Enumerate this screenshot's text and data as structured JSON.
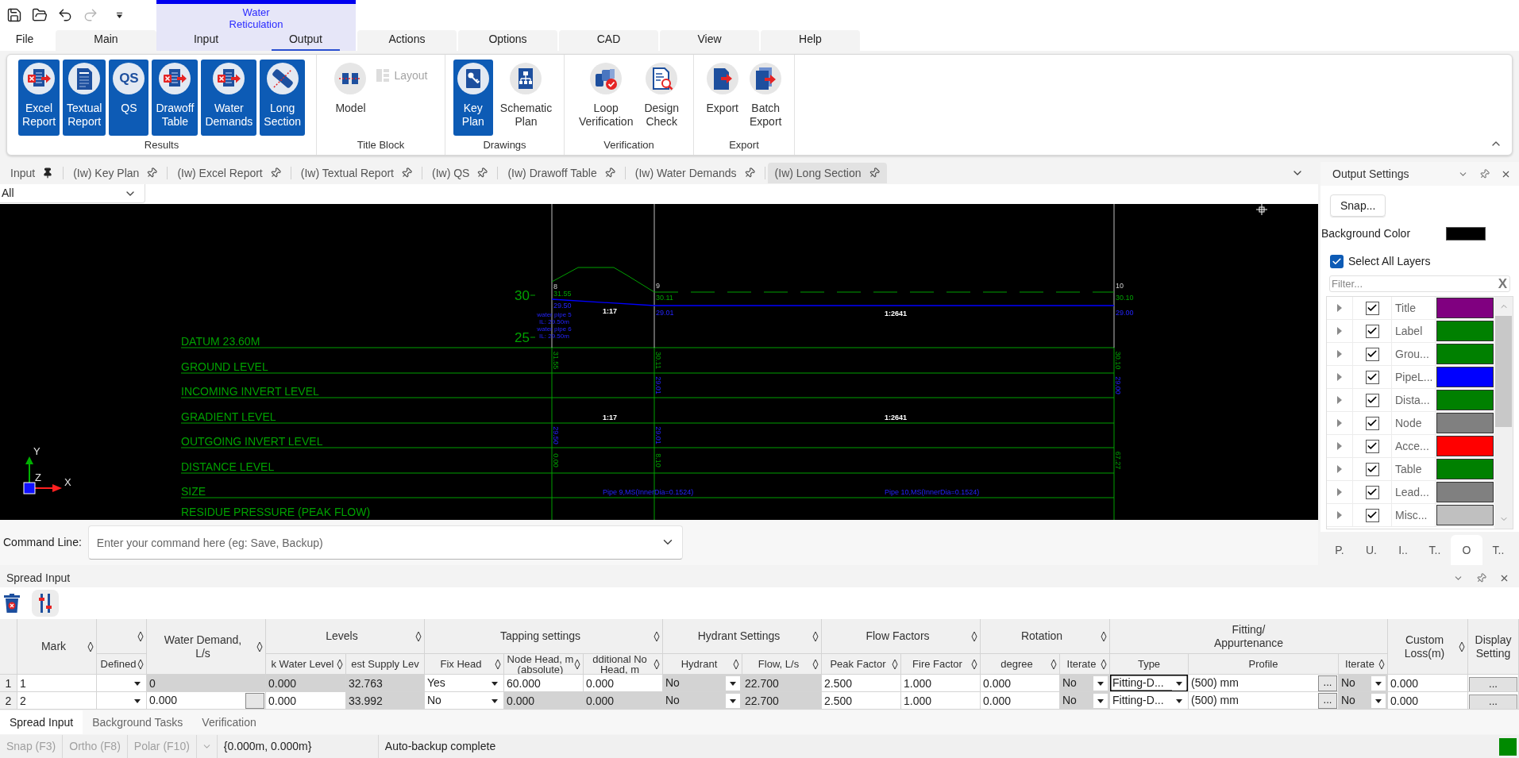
{
  "quick_access": [
    {
      "disabled": false
    },
    {
      "disabled": false
    },
    {
      "disabled": false
    },
    {
      "disabled": true
    },
    {
      "disabled": false
    }
  ],
  "menu": {
    "tabs_before": [
      {
        "label": "File",
        "kind": "backstage",
        "selected": false
      },
      {
        "label": "Main",
        "kind": "tab",
        "selected": false
      }
    ],
    "context_group": {
      "title": "Water Reticulation",
      "tabs": [
        {
          "label": "Input",
          "selected": false
        },
        {
          "label": "Output",
          "selected": true
        }
      ]
    },
    "tabs_after": [
      {
        "label": "Actions",
        "kind": "tab",
        "selected": false
      },
      {
        "label": "Options",
        "kind": "tab",
        "selected": false
      },
      {
        "label": "CAD",
        "kind": "tab",
        "selected": false
      },
      {
        "label": "View",
        "kind": "tab",
        "selected": false
      },
      {
        "label": "Help",
        "kind": "tab",
        "selected": false
      }
    ]
  },
  "ribbon": {
    "groups": [
      {
        "label": "Results",
        "buttons": [
          {
            "label": "Excel Report",
            "kind": "large",
            "selected": true,
            "disabled": false
          },
          {
            "label": "Textual Report",
            "kind": "large",
            "selected": true,
            "disabled": false
          },
          {
            "label": "QS",
            "icon_text": "QS",
            "kind": "large",
            "selected": true,
            "disabled": false
          },
          {
            "label": "Drawoff Table",
            "kind": "large",
            "selected": true,
            "disabled": false
          },
          {
            "label": "Water Demands",
            "kind": "large",
            "selected": true,
            "disabled": false
          },
          {
            "label": "Long Section",
            "kind": "large",
            "selected": true,
            "disabled": false
          }
        ]
      },
      {
        "label": "Title Block",
        "buttons": [
          {
            "label": "Model",
            "kind": "large",
            "selected": false,
            "disabled": false
          },
          {
            "label": "Layout",
            "kind": "small",
            "selected": false,
            "disabled": true
          }
        ]
      },
      {
        "label": "Drawings",
        "buttons": [
          {
            "label": "Key Plan",
            "kind": "large",
            "selected": true,
            "disabled": false
          },
          {
            "label": "Schematic Plan",
            "kind": "large",
            "selected": false,
            "disabled": false
          }
        ]
      },
      {
        "label": "Verification",
        "buttons": [
          {
            "label": "Loop Verification",
            "kind": "large",
            "selected": false,
            "disabled": false
          },
          {
            "label": "Design Check",
            "kind": "large",
            "selected": false,
            "disabled": false
          }
        ]
      },
      {
        "label": "Export",
        "buttons": [
          {
            "label": "Export",
            "kind": "large",
            "selected": false,
            "disabled": false
          },
          {
            "label": "Batch Export",
            "kind": "large",
            "selected": false,
            "disabled": false
          }
        ]
      }
    ]
  },
  "document_tabs": [
    {
      "label": "Input",
      "pinned": true,
      "selected": false
    },
    {
      "label": "(Iw) Key Plan",
      "pinned": false,
      "selected": false
    },
    {
      "label": "(Iw) Excel Report",
      "pinned": false,
      "selected": false
    },
    {
      "label": "(Iw) Textual Report",
      "pinned": false,
      "selected": false
    },
    {
      "label": "(Iw) QS",
      "pinned": false,
      "selected": false
    },
    {
      "label": "(Iw) Drawoff Table",
      "pinned": false,
      "selected": false
    },
    {
      "label": "(Iw) Water Demands",
      "pinned": false,
      "selected": false
    },
    {
      "label": "(Iw) Long Section",
      "pinned": false,
      "selected": true
    }
  ],
  "view_filter": {
    "value": "All"
  },
  "canvas": {
    "rows": [
      {
        "label": "DATUM 23.60M"
      },
      {
        "label": "GROUND LEVEL"
      },
      {
        "label": "INCOMING INVERT LEVEL"
      },
      {
        "label": "GRADIENT LEVEL"
      },
      {
        "label": "OUTGOING INVERT LEVEL"
      },
      {
        "label": "DISTANCE LEVEL"
      },
      {
        "label": "SIZE"
      },
      {
        "label": "RESIDUE PRESSURE (PEAK FLOW)"
      }
    ],
    "scale_labels": [
      "30",
      "25"
    ],
    "nodes": [
      {
        "label": "8",
        "ground": "31.55",
        "invert": "29.50",
        "ground_level_row": "31.55",
        "outgoing_invert_row": "29.50",
        "distance_row": "0.00"
      },
      {
        "label": "9",
        "ground": "30.11",
        "invert": "29.01",
        "ground_level_row": "30.11",
        "incoming_invert_row": "29.01",
        "outgoing_invert_row": "29.01",
        "distance_row": "8.10"
      },
      {
        "label": "10",
        "ground": "30.10",
        "invert": "29.00",
        "ground_level_row": "30.10",
        "incoming_invert_row": "29.00",
        "distance_row": "67.27"
      }
    ],
    "pipe_notes": [
      "water pipe 5",
      "IL: 29.50m",
      "water pipe 6",
      "IL: 29.50m"
    ],
    "pipes": [
      {
        "profile_gradient": "1:17",
        "row_gradient": "1:17",
        "size": "Pipe 9,MS(InnerDia=0.1524)"
      },
      {
        "profile_gradient": "1:2641",
        "row_gradient": "1:2641",
        "size": "Pipe 10,MS(InnerDia=0.1524)"
      }
    ],
    "axis_labels": [
      "Y",
      "Z",
      "X"
    ]
  },
  "command_line": {
    "label": "Command Line:",
    "placeholder": "Enter your command here (eg: Save, Backup)"
  },
  "output_settings": {
    "title": "Output Settings",
    "snap_button": "Snap...",
    "background": {
      "label": "Background Color",
      "color": "#000000"
    },
    "select_all": {
      "label": "Select All Layers",
      "checked": true
    },
    "filter": {
      "placeholder": "Filter...",
      "clear_label": "X"
    },
    "layers": [
      {
        "name": "Title",
        "expanded": false,
        "checked": true,
        "color": "#800080"
      },
      {
        "name": "Label",
        "expanded": false,
        "checked": true,
        "color": "#008000"
      },
      {
        "name": "Grou...",
        "expanded": false,
        "checked": true,
        "color": "#008000"
      },
      {
        "name": "PipeL...",
        "expanded": false,
        "checked": true,
        "color": "#0000ff"
      },
      {
        "name": "Dista...",
        "expanded": false,
        "checked": true,
        "color": "#008000"
      },
      {
        "name": "Node",
        "expanded": false,
        "checked": true,
        "color": "#808080"
      },
      {
        "name": "Acce...",
        "expanded": false,
        "checked": true,
        "color": "#ff0000"
      },
      {
        "name": "Table",
        "expanded": false,
        "checked": true,
        "color": "#008000"
      },
      {
        "name": "Lead...",
        "expanded": false,
        "checked": true,
        "color": "#808080"
      },
      {
        "name": "Misc...",
        "expanded": false,
        "checked": true,
        "color": "#c0c0c0"
      }
    ],
    "tabs": [
      {
        "label": "P.",
        "selected": false
      },
      {
        "label": "U.",
        "selected": false
      },
      {
        "label": "I..",
        "selected": false
      },
      {
        "label": "T..",
        "selected": false
      },
      {
        "label": "O",
        "selected": true
      },
      {
        "label": "T..",
        "selected": false
      }
    ]
  },
  "spread_input": {
    "title": "Spread Input",
    "header": [
      {
        "kind": "single",
        "label": "Mark",
        "sortable": true
      },
      {
        "kind": "group",
        "sortable": true,
        "columns": [
          {
            "label": "Defined",
            "sortable": true
          }
        ]
      },
      {
        "kind": "single",
        "label": "Water Demand, L/s",
        "sortable": true
      },
      {
        "kind": "group",
        "label": "Levels",
        "sortable": true,
        "columns": [
          {
            "label": "k Water Level",
            "sortable": true
          },
          {
            "label": "est Supply Lev",
            "sortable": false
          }
        ]
      },
      {
        "kind": "group",
        "label": "Tapping settings",
        "sortable": true,
        "columns": [
          {
            "label": "Fix Head",
            "sortable": true
          },
          {
            "label": "Node Head, m (absolute)",
            "sortable": true
          },
          {
            "label": "dditional No Head, m",
            "sortable": true
          }
        ]
      },
      {
        "kind": "group",
        "label": "Hydrant Settings",
        "sortable": true,
        "columns": [
          {
            "label": "Hydrant",
            "sortable": true
          },
          {
            "label": "Flow, L/s",
            "sortable": true
          }
        ]
      },
      {
        "kind": "group",
        "label": "Flow Factors",
        "sortable": true,
        "columns": [
          {
            "label": "Peak Factor",
            "sortable": true
          },
          {
            "label": "Fire Factor",
            "sortable": true
          }
        ]
      },
      {
        "kind": "group",
        "label": "Rotation",
        "sortable": true,
        "columns": [
          {
            "label": "degree",
            "sortable": true
          },
          {
            "label": "Iterate",
            "sortable": true
          }
        ]
      },
      {
        "kind": "group",
        "label": "Fitting/ Appurtenance",
        "sortable": false,
        "columns": [
          {
            "label": "Type",
            "sortable": false
          },
          {
            "label": "Profile",
            "sortable": false
          },
          {
            "label": "Iterate",
            "sortable": true
          }
        ]
      },
      {
        "kind": "single",
        "label": "Custom Loss(m)",
        "sortable": true
      },
      {
        "kind": "single",
        "label": "Display Setting",
        "sortable": false
      }
    ],
    "rows": [
      {
        "number": "1",
        "cells": [
          {
            "kind": "text",
            "value": "1",
            "readonly": false,
            "selected": false
          },
          {
            "kind": "dropdown",
            "readonly": false,
            "selected": false
          },
          {
            "kind": "text",
            "value": "0",
            "readonly": true,
            "selected": false
          },
          {
            "kind": "text",
            "value": "0.000",
            "readonly": true,
            "selected": false
          },
          {
            "kind": "text",
            "value": "32.763",
            "readonly": true,
            "selected": false
          },
          {
            "kind": "dropdown",
            "value": "Yes",
            "readonly": false,
            "selected": false
          },
          {
            "kind": "text",
            "value": "60.000",
            "readonly": false,
            "selected": false
          },
          {
            "kind": "text",
            "value": "0.000",
            "readonly": false,
            "selected": false
          },
          {
            "kind": "dropdown",
            "value": "No",
            "readonly": true,
            "selected": false
          },
          {
            "kind": "text",
            "value": "22.700",
            "readonly": true,
            "selected": false
          },
          {
            "kind": "text",
            "value": "2.500",
            "readonly": false,
            "selected": false
          },
          {
            "kind": "text",
            "value": "1.000",
            "readonly": false,
            "selected": false
          },
          {
            "kind": "text",
            "value": "0.000",
            "readonly": false,
            "selected": false
          },
          {
            "kind": "dropdown",
            "value": "No",
            "readonly": true,
            "selected": false
          },
          {
            "kind": "dropdown",
            "value": "Fitting-D...",
            "readonly": false,
            "selected": true
          },
          {
            "kind": "browse",
            "value": "(500) mm",
            "button": "...",
            "readonly": false,
            "selected": false
          },
          {
            "kind": "dropdown",
            "value": "No",
            "readonly": true,
            "selected": false
          },
          {
            "kind": "text",
            "value": "0.000",
            "readonly": false,
            "selected": false
          },
          {
            "kind": "button",
            "label": "...",
            "selected": false
          }
        ]
      },
      {
        "number": "2",
        "cells": [
          {
            "kind": "text",
            "value": "2",
            "readonly": false,
            "selected": false
          },
          {
            "kind": "dropdown",
            "readonly": false,
            "selected": false
          },
          {
            "kind": "browse",
            "value": "0.000",
            "readonly": false,
            "selected": false
          },
          {
            "kind": "text",
            "value": "0.000",
            "readonly": false,
            "selected": false
          },
          {
            "kind": "text",
            "value": "33.992",
            "readonly": true,
            "selected": false
          },
          {
            "kind": "dropdown",
            "value": "No",
            "readonly": false,
            "selected": false
          },
          {
            "kind": "text",
            "value": "0.000",
            "readonly": true,
            "selected": false
          },
          {
            "kind": "text",
            "value": "0.000",
            "readonly": true,
            "selected": false
          },
          {
            "kind": "dropdown",
            "value": "No",
            "readonly": true,
            "selected": false
          },
          {
            "kind": "text",
            "value": "22.700",
            "readonly": true,
            "selected": false
          },
          {
            "kind": "text",
            "value": "2.500",
            "readonly": false,
            "selected": false
          },
          {
            "kind": "text",
            "value": "1.000",
            "readonly": false,
            "selected": false
          },
          {
            "kind": "text",
            "value": "0.000",
            "readonly": false,
            "selected": false
          },
          {
            "kind": "dropdown",
            "value": "No",
            "readonly": true,
            "selected": false
          },
          {
            "kind": "dropdown",
            "value": "Fitting-D...",
            "readonly": false,
            "selected": false
          },
          {
            "kind": "browse",
            "value": "(500) mm",
            "button": "...",
            "readonly": false,
            "selected": false
          },
          {
            "kind": "dropdown",
            "value": "No",
            "readonly": true,
            "selected": false
          },
          {
            "kind": "text",
            "value": "0.000",
            "readonly": false,
            "selected": false
          },
          {
            "kind": "button",
            "label": "...",
            "selected": false
          }
        ]
      }
    ]
  },
  "bottom_tabs": [
    {
      "label": "Spread Input",
      "selected": true
    },
    {
      "label": "Background Tasks",
      "selected": false
    },
    {
      "label": "Verification",
      "selected": false
    }
  ],
  "status_bar": {
    "toggles": [
      {
        "label": "Snap (F3)",
        "on": false
      },
      {
        "label": "Ortho (F8)",
        "on": false
      },
      {
        "label": "Polar (F10)",
        "on": false
      }
    ],
    "coordinates": "{0.000m, 0.000m}",
    "message": "Auto-backup complete"
  }
}
